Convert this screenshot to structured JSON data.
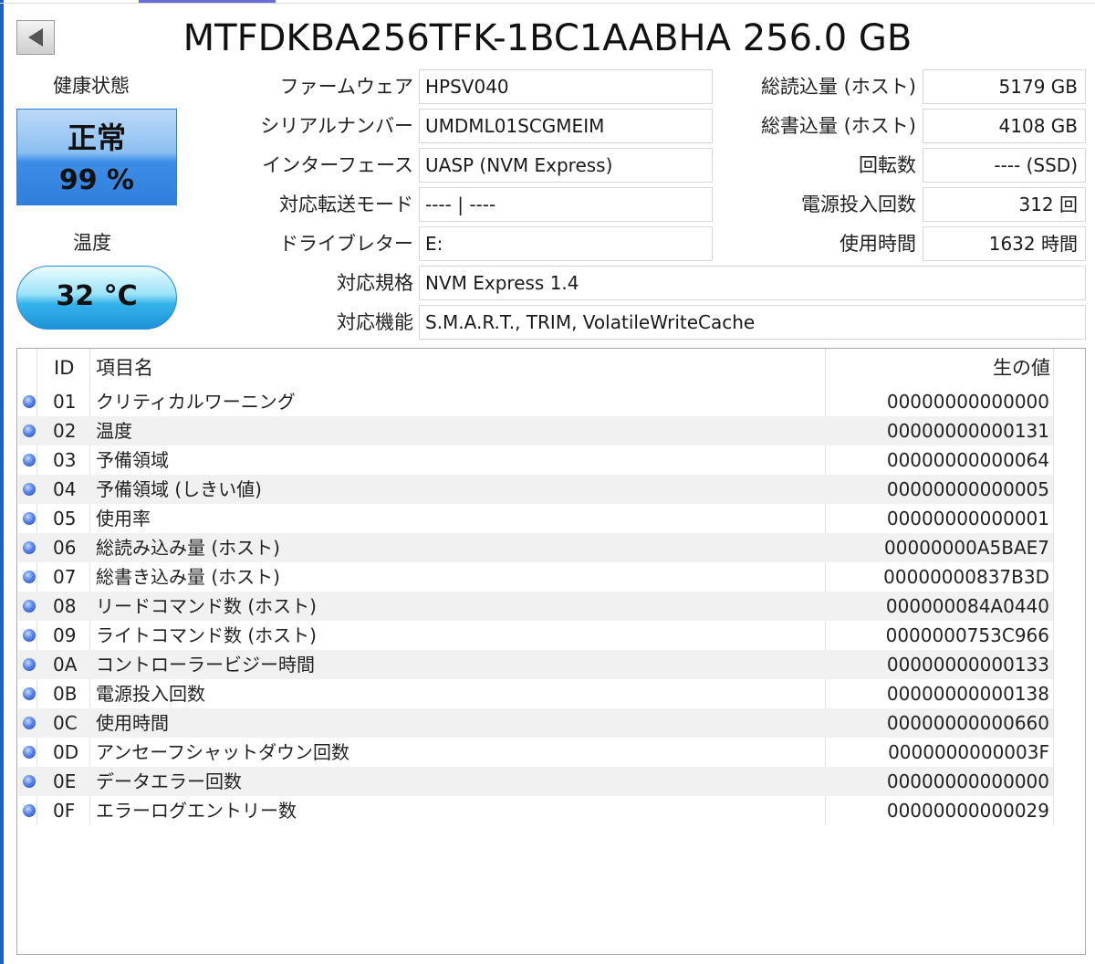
{
  "window": {
    "title": "MTFDKBA256TFK-1BC1AABHA 256.0 GB"
  },
  "health": {
    "label": "健康状態",
    "status": "正常",
    "percent": "99 %",
    "color": "#3d8ee6"
  },
  "temperature": {
    "label": "温度",
    "value": "32 °C",
    "color": "#34b3ea"
  },
  "info": {
    "firmware": {
      "label": "ファームウェア",
      "value": "HPSV040"
    },
    "serial": {
      "label": "シリアルナンバー",
      "value": "UMDML01SCGMEIM"
    },
    "interface": {
      "label": "インターフェース",
      "value": "UASP (NVM Express)"
    },
    "transfer_mode": {
      "label": "対応転送モード",
      "value": "---- | ----"
    },
    "drive_letter": {
      "label": "ドライブレター",
      "value": "E:"
    },
    "standard": {
      "label": "対応規格",
      "value": "NVM Express 1.4"
    },
    "features": {
      "label": "対応機能",
      "value": "S.M.A.R.T., TRIM, VolatileWriteCache"
    },
    "host_reads": {
      "label": "総読込量 (ホスト)",
      "value": "5179 GB"
    },
    "host_writes": {
      "label": "総書込量 (ホスト)",
      "value": "4108 GB"
    },
    "rotation": {
      "label": "回転数",
      "value": "---- (SSD)"
    },
    "power_on_count": {
      "label": "電源投入回数",
      "value": "312 回"
    },
    "power_on_hours": {
      "label": "使用時間",
      "value": "1632 時間"
    }
  },
  "smart": {
    "columns": {
      "id": "ID",
      "name": "項目名",
      "raw": "生の値"
    },
    "rows": [
      {
        "id": "01",
        "name": "クリティカルワーニング",
        "raw": "00000000000000"
      },
      {
        "id": "02",
        "name": "温度",
        "raw": "00000000000131"
      },
      {
        "id": "03",
        "name": "予備領域",
        "raw": "00000000000064"
      },
      {
        "id": "04",
        "name": "予備領域 (しきい値)",
        "raw": "00000000000005"
      },
      {
        "id": "05",
        "name": "使用率",
        "raw": "00000000000001"
      },
      {
        "id": "06",
        "name": "総読み込み量 (ホスト)",
        "raw": "00000000A5BAE7"
      },
      {
        "id": "07",
        "name": "総書き込み量 (ホスト)",
        "raw": "00000000837B3D"
      },
      {
        "id": "08",
        "name": "リードコマンド数 (ホスト)",
        "raw": "000000084A0440"
      },
      {
        "id": "09",
        "name": "ライトコマンド数 (ホスト)",
        "raw": "0000000753C966"
      },
      {
        "id": "0A",
        "name": "コントローラービジー時間",
        "raw": "00000000000133"
      },
      {
        "id": "0B",
        "name": "電源投入回数",
        "raw": "00000000000138"
      },
      {
        "id": "0C",
        "name": "使用時間",
        "raw": "00000000000660"
      },
      {
        "id": "0D",
        "name": "アンセーフシャットダウン回数",
        "raw": "0000000000003F"
      },
      {
        "id": "0E",
        "name": "データエラー回数",
        "raw": "00000000000000"
      },
      {
        "id": "0F",
        "name": "エラーログエントリー数",
        "raw": "00000000000029"
      }
    ]
  }
}
